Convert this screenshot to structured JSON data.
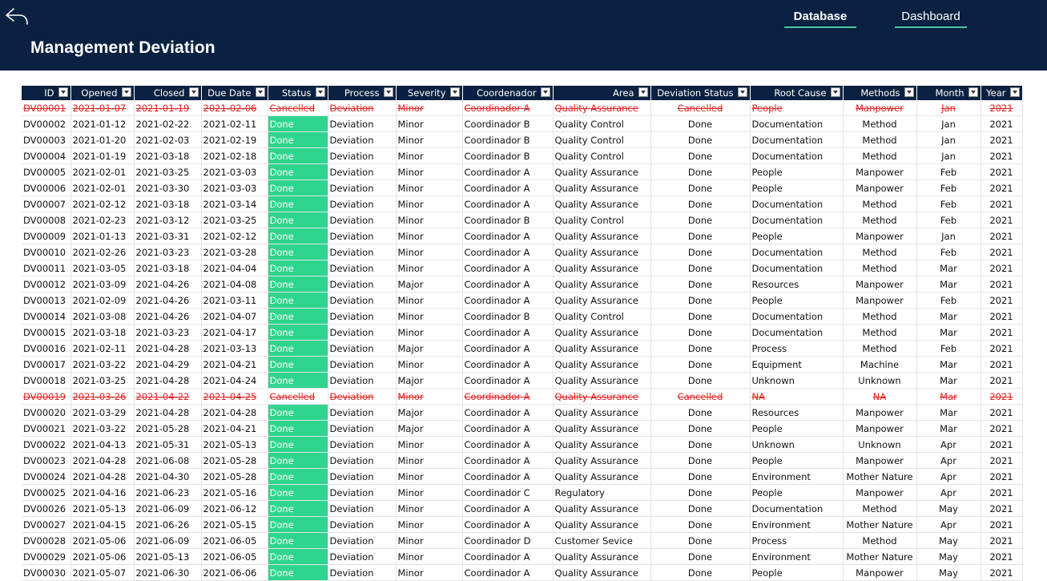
{
  "header": {
    "title": "Management Deviation",
    "back_icon": "back-arrow-icon"
  },
  "nav": {
    "database": "Database",
    "dashboard": "Dashboard"
  },
  "colors": {
    "header_bg": "#0b2142",
    "done_bg": "#2fd48e",
    "cancel_text": "#e02020",
    "nav_underline": "#4fc39a"
  },
  "table": {
    "columns": [
      "ID",
      "Opened",
      "Closed",
      "Due Date",
      "Status",
      "Process",
      "Severity",
      "Coordenador",
      "Area",
      "Deviation Status",
      "Root Cause",
      "Methods",
      "Month",
      "Year"
    ],
    "rows": [
      [
        "DV00001",
        "2021-01-07",
        "2021-01-19",
        "2021-02-06",
        "Cancelled",
        "Deviation",
        "Minor",
        "Coordinador A",
        "Quality Assurance",
        "Cancelled",
        "People",
        "Manpower",
        "Jan",
        "2021"
      ],
      [
        "DV00002",
        "2021-01-12",
        "2021-02-22",
        "2021-02-11",
        "Done",
        "Deviation",
        "Minor",
        "Coordinador B",
        "Quality Control",
        "Done",
        "Documentation",
        "Method",
        "Jan",
        "2021"
      ],
      [
        "DV00003",
        "2021-01-20",
        "2021-02-03",
        "2021-02-19",
        "Done",
        "Deviation",
        "Minor",
        "Coordinador B",
        "Quality Control",
        "Done",
        "Documentation",
        "Method",
        "Jan",
        "2021"
      ],
      [
        "DV00004",
        "2021-01-19",
        "2021-03-18",
        "2021-02-18",
        "Done",
        "Deviation",
        "Minor",
        "Coordinador B",
        "Quality Control",
        "Done",
        "Documentation",
        "Method",
        "Jan",
        "2021"
      ],
      [
        "DV00005",
        "2021-02-01",
        "2021-03-25",
        "2021-03-03",
        "Done",
        "Deviation",
        "Minor",
        "Coordinador A",
        "Quality Assurance",
        "Done",
        "People",
        "Manpower",
        "Feb",
        "2021"
      ],
      [
        "DV00006",
        "2021-02-01",
        "2021-03-30",
        "2021-03-03",
        "Done",
        "Deviation",
        "Minor",
        "Coordinador A",
        "Quality Assurance",
        "Done",
        "People",
        "Manpower",
        "Feb",
        "2021"
      ],
      [
        "DV00007",
        "2021-02-12",
        "2021-03-18",
        "2021-03-14",
        "Done",
        "Deviation",
        "Minor",
        "Coordinador A",
        "Quality Assurance",
        "Done",
        "Documentation",
        "Method",
        "Feb",
        "2021"
      ],
      [
        "DV00008",
        "2021-02-23",
        "2021-03-12",
        "2021-03-25",
        "Done",
        "Deviation",
        "Minor",
        "Coordinador B",
        "Quality Control",
        "Done",
        "Documentation",
        "Method",
        "Feb",
        "2021"
      ],
      [
        "DV00009",
        "2021-01-13",
        "2021-03-31",
        "2021-02-12",
        "Done",
        "Deviation",
        "Minor",
        "Coordinador A",
        "Quality Assurance",
        "Done",
        "People",
        "Manpower",
        "Jan",
        "2021"
      ],
      [
        "DV00010",
        "2021-02-26",
        "2021-03-23",
        "2021-03-28",
        "Done",
        "Deviation",
        "Minor",
        "Coordinador A",
        "Quality Assurance",
        "Done",
        "Documentation",
        "Method",
        "Feb",
        "2021"
      ],
      [
        "DV00011",
        "2021-03-05",
        "2021-03-18",
        "2021-04-04",
        "Done",
        "Deviation",
        "Minor",
        "Coordinador A",
        "Quality Assurance",
        "Done",
        "Documentation",
        "Method",
        "Mar",
        "2021"
      ],
      [
        "DV00012",
        "2021-03-09",
        "2021-04-26",
        "2021-04-08",
        "Done",
        "Deviation",
        "Major",
        "Coordinador A",
        "Quality Assurance",
        "Done",
        "Resources",
        "Manpower",
        "Mar",
        "2021"
      ],
      [
        "DV00013",
        "2021-02-09",
        "2021-04-26",
        "2021-03-11",
        "Done",
        "Deviation",
        "Minor",
        "Coordinador A",
        "Quality Assurance",
        "Done",
        "People",
        "Manpower",
        "Feb",
        "2021"
      ],
      [
        "DV00014",
        "2021-03-08",
        "2021-04-26",
        "2021-04-07",
        "Done",
        "Deviation",
        "Minor",
        "Coordinador B",
        "Quality Control",
        "Done",
        "Documentation",
        "Method",
        "Mar",
        "2021"
      ],
      [
        "DV00015",
        "2021-03-18",
        "2021-03-23",
        "2021-04-17",
        "Done",
        "Deviation",
        "Minor",
        "Coordinador A",
        "Quality Assurance",
        "Done",
        "Documentation",
        "Method",
        "Mar",
        "2021"
      ],
      [
        "DV00016",
        "2021-02-11",
        "2021-04-28",
        "2021-03-13",
        "Done",
        "Deviation",
        "Major",
        "Coordinador A",
        "Quality Assurance",
        "Done",
        "Process",
        "Method",
        "Feb",
        "2021"
      ],
      [
        "DV00017",
        "2021-03-22",
        "2021-04-29",
        "2021-04-21",
        "Done",
        "Deviation",
        "Minor",
        "Coordinador A",
        "Quality Assurance",
        "Done",
        "Equipment",
        "Machine",
        "Mar",
        "2021"
      ],
      [
        "DV00018",
        "2021-03-25",
        "2021-04-28",
        "2021-04-24",
        "Done",
        "Deviation",
        "Major",
        "Coordinador A",
        "Quality Assurance",
        "Done",
        "Unknown",
        "Unknown",
        "Mar",
        "2021"
      ],
      [
        "DV00019",
        "2021-03-26",
        "2021-04-22",
        "2021-04-25",
        "Cancelled",
        "Deviation",
        "Minor",
        "Coordinador A",
        "Quality Assurance",
        "Cancelled",
        "NA",
        "NA",
        "Mar",
        "2021"
      ],
      [
        "DV00020",
        "2021-03-29",
        "2021-04-28",
        "2021-04-28",
        "Done",
        "Deviation",
        "Major",
        "Coordinador A",
        "Quality Assurance",
        "Done",
        "Resources",
        "Manpower",
        "Mar",
        "2021"
      ],
      [
        "DV00021",
        "2021-03-22",
        "2021-05-28",
        "2021-04-21",
        "Done",
        "Deviation",
        "Major",
        "Coordinador A",
        "Quality Assurance",
        "Done",
        "People",
        "Manpower",
        "Mar",
        "2021"
      ],
      [
        "DV00022",
        "2021-04-13",
        "2021-05-31",
        "2021-05-13",
        "Done",
        "Deviation",
        "Minor",
        "Coordinador A",
        "Quality Assurance",
        "Done",
        "Unknown",
        "Unknown",
        "Apr",
        "2021"
      ],
      [
        "DV00023",
        "2021-04-28",
        "2021-06-08",
        "2021-05-28",
        "Done",
        "Deviation",
        "Minor",
        "Coordinador A",
        "Quality Assurance",
        "Done",
        "People",
        "Manpower",
        "Apr",
        "2021"
      ],
      [
        "DV00024",
        "2021-04-28",
        "2021-04-30",
        "2021-05-28",
        "Done",
        "Deviation",
        "Minor",
        "Coordinador A",
        "Quality Assurance",
        "Done",
        "Environment",
        "Mother Nature",
        "Apr",
        "2021"
      ],
      [
        "DV00025",
        "2021-04-16",
        "2021-06-23",
        "2021-05-16",
        "Done",
        "Deviation",
        "Minor",
        "Coordinador C",
        "Regulatory",
        "Done",
        "People",
        "Manpower",
        "Apr",
        "2021"
      ],
      [
        "DV00026",
        "2021-05-13",
        "2021-06-09",
        "2021-06-12",
        "Done",
        "Deviation",
        "Minor",
        "Coordinador A",
        "Quality Assurance",
        "Done",
        "Documentation",
        "Method",
        "May",
        "2021"
      ],
      [
        "DV00027",
        "2021-04-15",
        "2021-06-26",
        "2021-05-15",
        "Done",
        "Deviation",
        "Minor",
        "Coordinador A",
        "Quality Assurance",
        "Done",
        "Environment",
        "Mother Nature",
        "Apr",
        "2021"
      ],
      [
        "DV00028",
        "2021-05-06",
        "2021-06-09",
        "2021-06-05",
        "Done",
        "Deviation",
        "Minor",
        "Coordinador D",
        "Customer Sevice",
        "Done",
        "Process",
        "Method",
        "May",
        "2021"
      ],
      [
        "DV00029",
        "2021-05-06",
        "2021-05-13",
        "2021-06-05",
        "Done",
        "Deviation",
        "Minor",
        "Coordinador A",
        "Quality Assurance",
        "Done",
        "Environment",
        "Mother Nature",
        "May",
        "2021"
      ],
      [
        "DV00030",
        "2021-05-07",
        "2021-06-30",
        "2021-06-06",
        "Done",
        "Deviation",
        "Minor",
        "Coordinador A",
        "Quality Assurance",
        "Done",
        "People",
        "Manpower",
        "May",
        "2021"
      ]
    ]
  }
}
